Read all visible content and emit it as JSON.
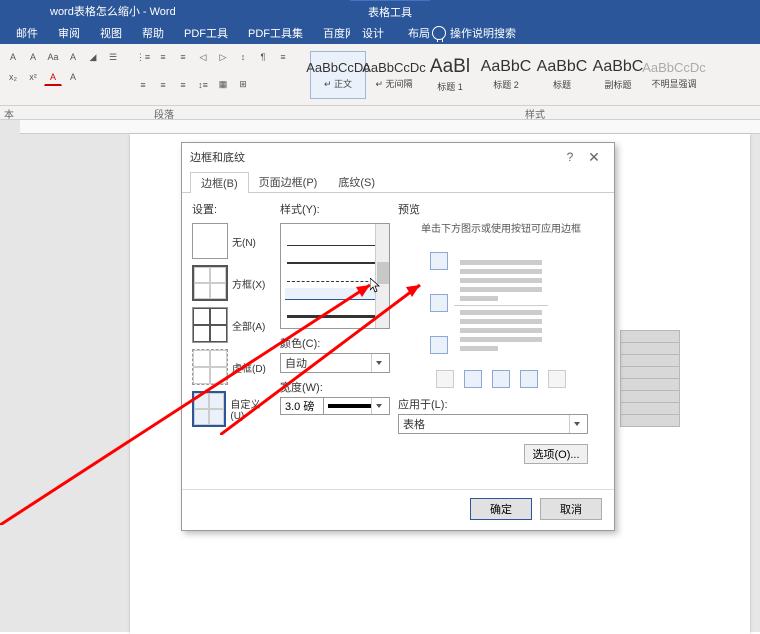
{
  "window_title": "word表格怎么缩小 - Word",
  "tool_category": "表格工具",
  "ribbon_tabs": [
    "邮件",
    "审阅",
    "视图",
    "帮助",
    "PDF工具",
    "PDF工具集",
    "百度网盘"
  ],
  "tool_subtabs": [
    "设计",
    "布局"
  ],
  "search_hint": "操作说明搜索",
  "group_paragraph": "段落",
  "group_styles": "样式",
  "styles": [
    {
      "preview": "AaBbCcDc",
      "label": "↵ 正文",
      "active": true,
      "big": false
    },
    {
      "preview": "AaBbCcDc",
      "label": "↵ 无间隔",
      "active": false,
      "big": false
    },
    {
      "preview": "AaBl",
      "label": "标题 1",
      "active": false,
      "big": true
    },
    {
      "preview": "AaBbC",
      "label": "标题 2",
      "active": false,
      "big": false
    },
    {
      "preview": "AaBbC",
      "label": "标题",
      "active": false,
      "big": false
    },
    {
      "preview": "AaBbC",
      "label": "副标题",
      "active": false,
      "big": false
    },
    {
      "preview": "AaBbCcDc",
      "label": "不明显强调",
      "active": false,
      "big": false
    }
  ],
  "dialog": {
    "title": "边框和底纹",
    "tabs": [
      "边框(B)",
      "页面边框(P)",
      "底纹(S)"
    ],
    "active_tab": 0,
    "section_setting": "设置:",
    "section_style": "样式(Y):",
    "section_preview": "预览",
    "settings": [
      {
        "label": "无(N)",
        "kind": "none"
      },
      {
        "label": "方框(X)",
        "kind": "box"
      },
      {
        "label": "全部(A)",
        "kind": "all"
      },
      {
        "label": "虚框(D)",
        "kind": "dashed"
      },
      {
        "label": "自定义(U)",
        "kind": "custom"
      }
    ],
    "color_label": "颜色(C):",
    "color_value": "自动",
    "width_label": "宽度(W):",
    "width_value": "3.0 磅",
    "preview_note": "单击下方图示或使用按钮可应用边框",
    "apply_label": "应用于(L):",
    "apply_value": "表格",
    "options_btn": "选项(O)...",
    "ok": "确定",
    "cancel": "取消"
  }
}
